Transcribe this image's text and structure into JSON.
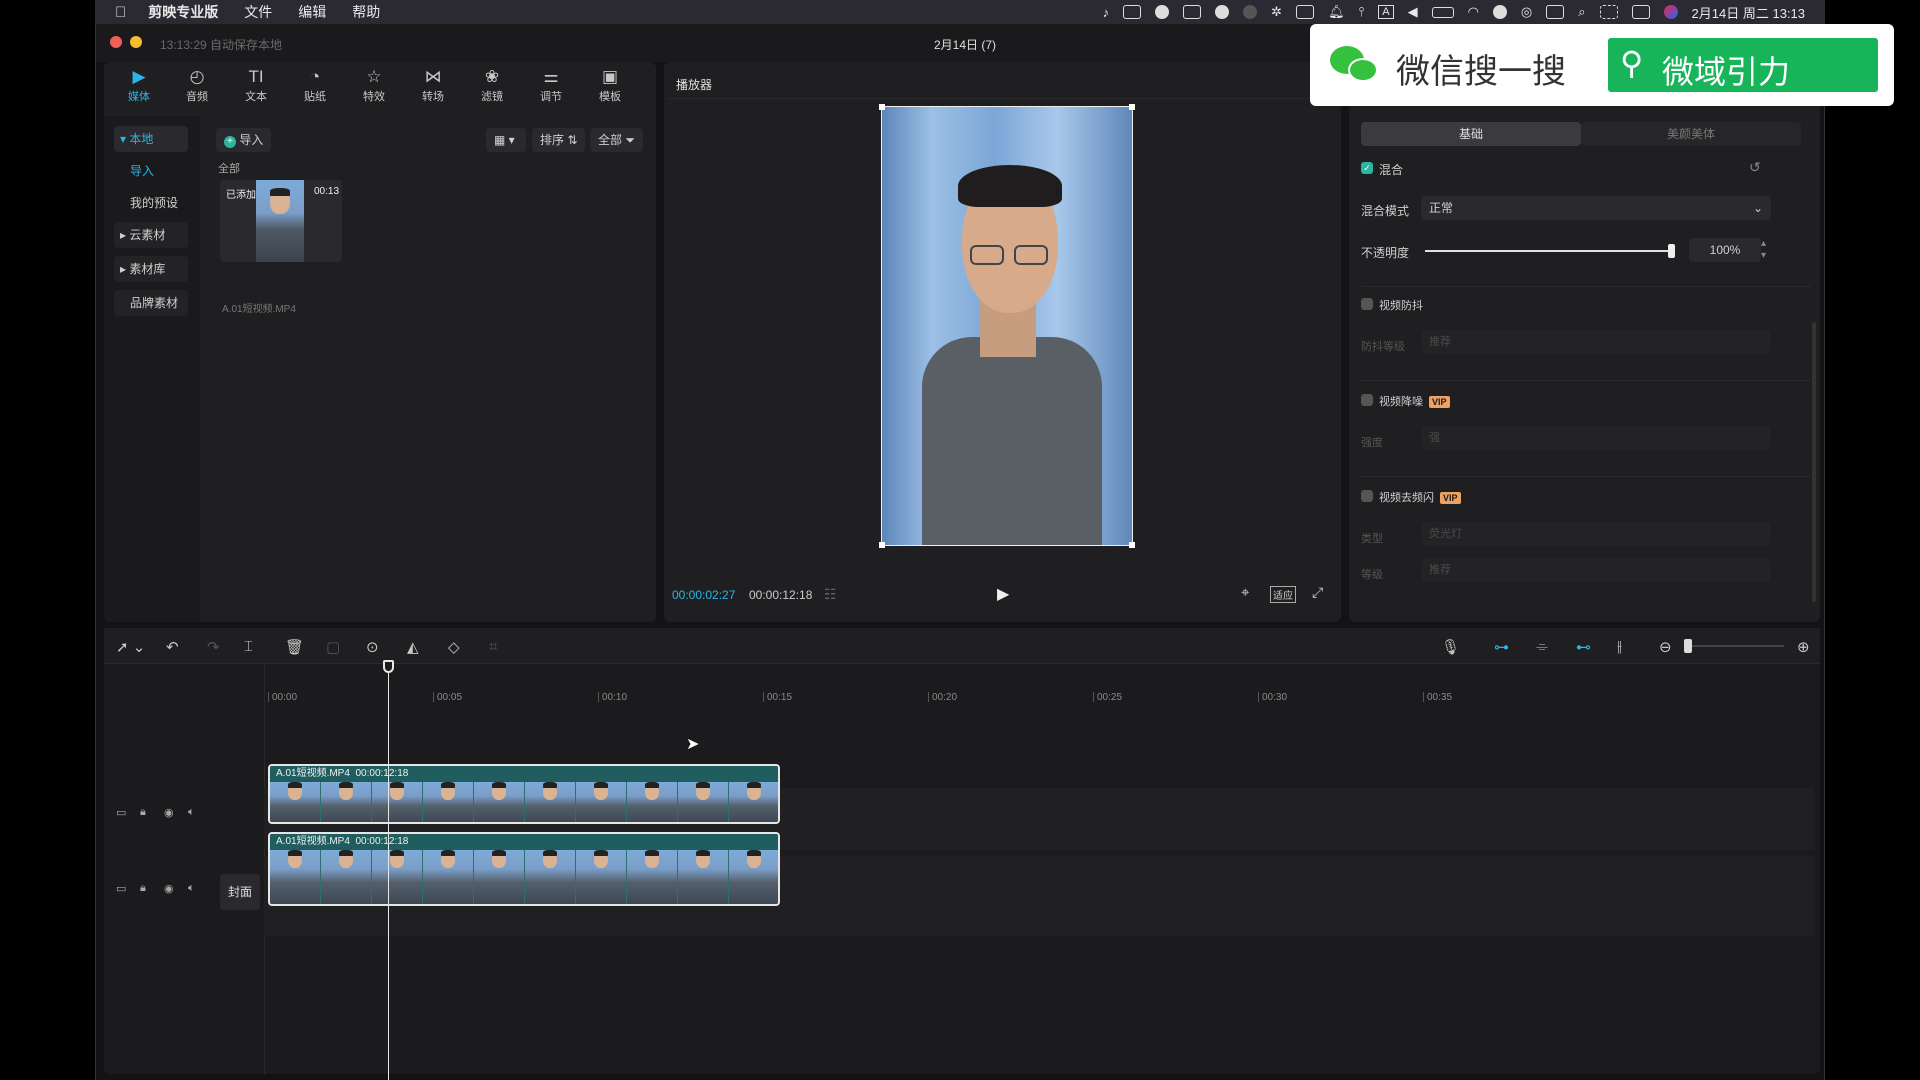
{
  "menubar": {
    "items": [
      "剪映专业版",
      "文件",
      "编辑",
      "帮助"
    ],
    "datetime": "2月14日 周二  13:13"
  },
  "window": {
    "autosave": "13:13:29 自动保存本地",
    "title": "2月14日 (7)"
  },
  "media_toolbar": [
    {
      "label": "媒体",
      "icon": "media-icon"
    },
    {
      "label": "音频",
      "icon": "audio-icon"
    },
    {
      "label": "文本",
      "icon": "text-icon"
    },
    {
      "label": "贴纸",
      "icon": "sticker-icon"
    },
    {
      "label": "特效",
      "icon": "effects-icon"
    },
    {
      "label": "转场",
      "icon": "transition-icon"
    },
    {
      "label": "滤镜",
      "icon": "filter-icon"
    },
    {
      "label": "调节",
      "icon": "adjust-icon"
    },
    {
      "label": "模板",
      "icon": "template-icon"
    }
  ],
  "sidebar": {
    "items": [
      "本地",
      "导入",
      "我的预设",
      "云素材",
      "素材库",
      "品牌素材"
    ]
  },
  "media": {
    "import_label": "导入",
    "sort_label": "排序",
    "all_filter_label": "全部",
    "section_label": "全部",
    "clip": {
      "added_badge": "已添加",
      "duration": "00:13",
      "filename": "A.01短视频.MP4"
    }
  },
  "player": {
    "title": "播放器",
    "current_time": "00:00:02:27",
    "total_time": "00:00:12:18",
    "fit_label": "适应"
  },
  "properties": {
    "tabs": [
      "基础",
      "美颜美体"
    ],
    "blend": {
      "label": "混合",
      "checked": true
    },
    "blend_mode": {
      "label": "混合模式",
      "value": "正常"
    },
    "opacity": {
      "label": "不透明度",
      "value": "100%",
      "level": 1.0
    },
    "stabilize": {
      "label": "视频防抖",
      "sub_label": "防抖等级",
      "sub_value": "推荐"
    },
    "denoise": {
      "label": "视频降噪",
      "vip": "VIP",
      "sub_label": "强度",
      "sub_value": "强"
    },
    "deflicker": {
      "label": "视频去频闪",
      "vip": "VIP",
      "type_label": "类型",
      "type_value": "荧光灯",
      "level_label": "等级",
      "level_value": "推荐"
    }
  },
  "timeline": {
    "ticks": [
      "00:00",
      "00:05",
      "00:10",
      "00:15",
      "00:20",
      "00:25",
      "00:30",
      "00:35"
    ],
    "cover_label": "封面",
    "clips": [
      {
        "name": "A.01短视频.MP4",
        "duration": "00:00:12:18"
      },
      {
        "name": "A.01短视频.MP4",
        "duration": "00:00:12:18"
      }
    ]
  },
  "wechat": {
    "search_label": "微信搜一搜",
    "query": "微域引力"
  }
}
